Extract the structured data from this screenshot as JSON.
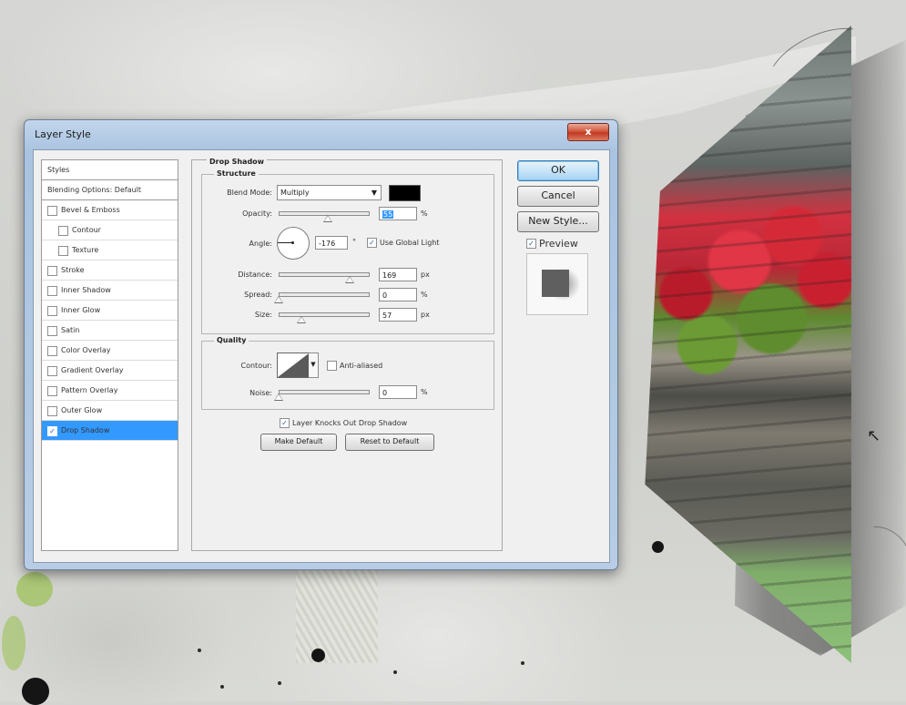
{
  "window": {
    "title": "Layer Style",
    "close_label": "x"
  },
  "styles_list": {
    "header": "Styles",
    "blending": "Blending Options: Default",
    "items": [
      {
        "label": "Bevel & Emboss",
        "checked": false,
        "indent": 0
      },
      {
        "label": "Contour",
        "checked": false,
        "indent": 1
      },
      {
        "label": "Texture",
        "checked": false,
        "indent": 1
      },
      {
        "label": "Stroke",
        "checked": false,
        "indent": 0
      },
      {
        "label": "Inner Shadow",
        "checked": false,
        "indent": 0
      },
      {
        "label": "Inner Glow",
        "checked": false,
        "indent": 0
      },
      {
        "label": "Satin",
        "checked": false,
        "indent": 0
      },
      {
        "label": "Color Overlay",
        "checked": false,
        "indent": 0
      },
      {
        "label": "Gradient Overlay",
        "checked": false,
        "indent": 0
      },
      {
        "label": "Pattern Overlay",
        "checked": false,
        "indent": 0
      },
      {
        "label": "Outer Glow",
        "checked": false,
        "indent": 0
      },
      {
        "label": "Drop Shadow",
        "checked": true,
        "indent": 0,
        "selected": true
      }
    ]
  },
  "drop_shadow": {
    "title": "Drop Shadow",
    "structure": {
      "title": "Structure",
      "blend_mode_label": "Blend Mode:",
      "blend_mode_value": "Multiply",
      "color": "#000000",
      "opacity_label": "Opacity:",
      "opacity_value": "55",
      "opacity_unit": "%",
      "opacity_fraction": 0.55,
      "angle_label": "Angle:",
      "angle_value": "-176",
      "angle_unit": "°",
      "use_global_light_label": "Use Global Light",
      "use_global_light": true,
      "distance_label": "Distance:",
      "distance_value": "169",
      "distance_unit": "px",
      "distance_fraction": 0.8,
      "spread_label": "Spread:",
      "spread_value": "0",
      "spread_unit": "%",
      "spread_fraction": 0.0,
      "size_label": "Size:",
      "size_value": "57",
      "size_unit": "px",
      "size_fraction": 0.25
    },
    "quality": {
      "title": "Quality",
      "contour_label": "Contour:",
      "anti_aliased_label": "Anti-aliased",
      "anti_aliased": false,
      "noise_label": "Noise:",
      "noise_value": "0",
      "noise_unit": "%",
      "noise_fraction": 0.0
    },
    "knockout_label": "Layer Knocks Out Drop Shadow",
    "knockout": true,
    "make_default_label": "Make Default",
    "reset_default_label": "Reset to Default"
  },
  "actions": {
    "ok_label": "OK",
    "cancel_label": "Cancel",
    "new_style_label": "New Style...",
    "preview_label": "Preview",
    "preview_checked": true
  },
  "icons": {
    "close": "close-icon",
    "check": "check-icon",
    "dropdown": "chevron-down-icon",
    "cursor": "rotate-cursor-icon"
  }
}
